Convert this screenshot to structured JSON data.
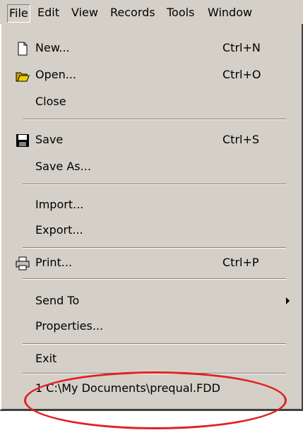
{
  "menubar": {
    "items": [
      {
        "label": "File",
        "active": true
      },
      {
        "label": "Edit"
      },
      {
        "label": "View"
      },
      {
        "label": "Records"
      },
      {
        "label": "Tools"
      },
      {
        "label": "Window"
      }
    ]
  },
  "file_menu": {
    "items": {
      "new": {
        "label": "New...",
        "shortcut": "Ctrl+N",
        "icon": "new-document-icon"
      },
      "open": {
        "label": "Open...",
        "shortcut": "Ctrl+O",
        "icon": "open-folder-icon"
      },
      "close": {
        "label": "Close"
      },
      "save": {
        "label": "Save",
        "shortcut": "Ctrl+S",
        "icon": "floppy-disk-icon"
      },
      "save_as": {
        "label": "Save As..."
      },
      "import": {
        "label": "Import..."
      },
      "export": {
        "label": "Export..."
      },
      "print": {
        "label": "Print...",
        "shortcut": "Ctrl+P",
        "icon": "printer-icon"
      },
      "send_to": {
        "label": "Send To"
      },
      "properties": {
        "label": "Properties..."
      },
      "exit": {
        "label": "Exit"
      },
      "recent_1": {
        "label": "1 C:\\My Documents\\prequal.FDD"
      }
    }
  },
  "annotation": {
    "color": "#e02020",
    "shape": "ellipse"
  }
}
